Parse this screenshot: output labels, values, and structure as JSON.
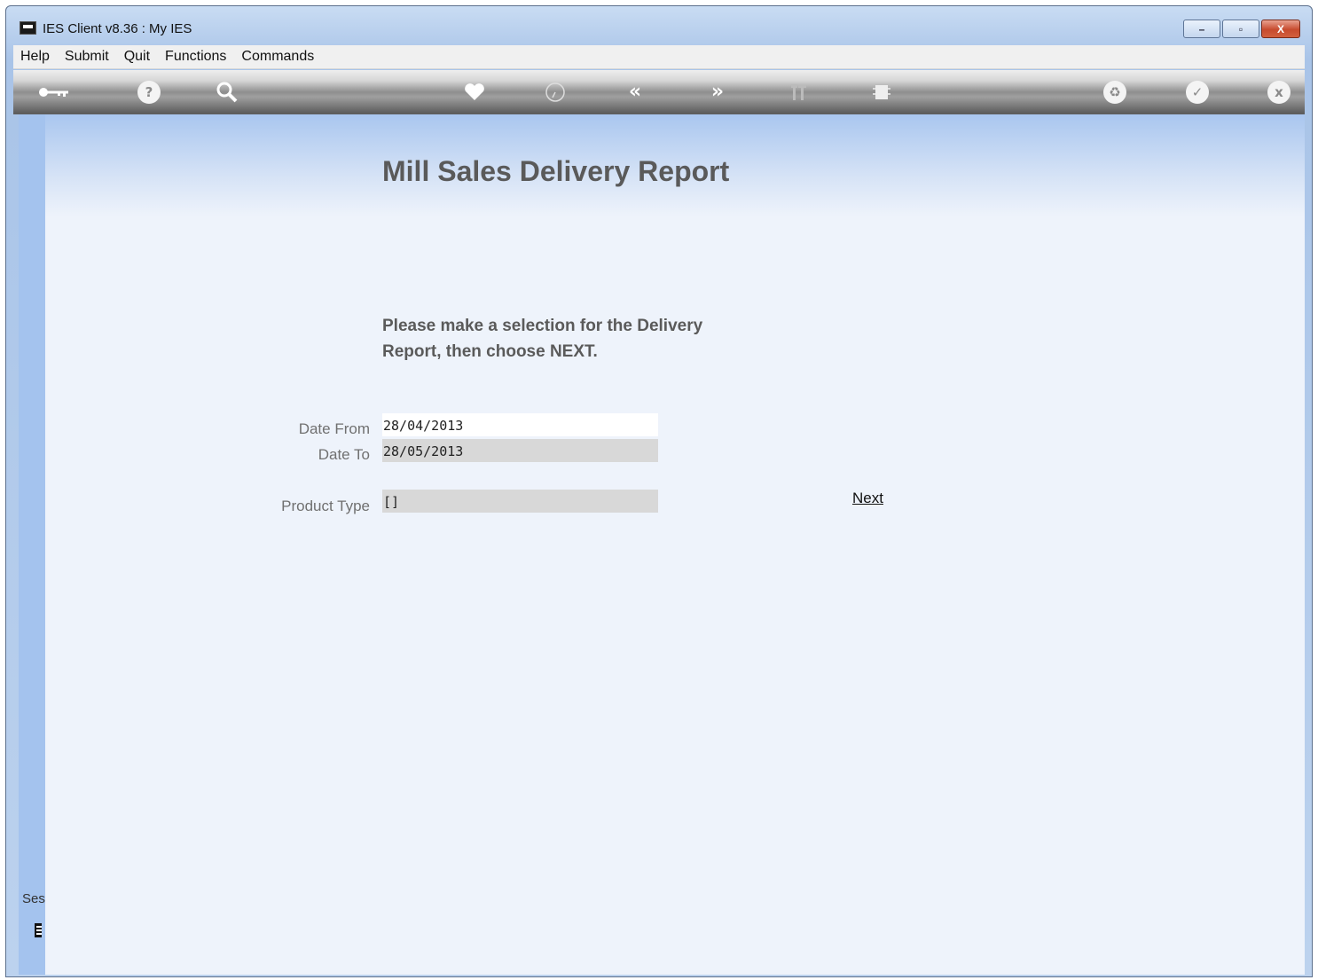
{
  "window": {
    "title": "IES Client v8.36 : My IES",
    "controls": {
      "minimize": "–",
      "maximize": "▫",
      "close": "X"
    }
  },
  "menubar": {
    "items": [
      "Help",
      "Submit",
      "Quit",
      "Functions",
      "Commands"
    ]
  },
  "toolbar": {
    "icons": [
      "key-icon",
      "help-icon",
      "search-icon",
      "favorite-heart-icon",
      "history-clock-icon",
      "previous-icon",
      "next-icon",
      "tools-icon",
      "chip-icon",
      "recycle-icon",
      "ok-check-icon",
      "close-x-icon"
    ]
  },
  "form": {
    "title": "Mill Sales Delivery Report",
    "instructions": "Please make a selection for the Delivery Report, then choose NEXT.",
    "fields": [
      {
        "label": "Date From",
        "value": "28/04/2013"
      },
      {
        "label": "Date To",
        "value": "28/05/2013"
      },
      {
        "label": "Product Type",
        "value": "[]"
      }
    ],
    "next_label": "Next"
  },
  "sidebar": {
    "label": "Ses"
  },
  "colors": {
    "title_text": "#5a5a5a",
    "field_label": "#707070",
    "active_field_bg": "#ffffff",
    "inactive_field_bg": "#d8d8d8",
    "pane_bg": "#eef3fb",
    "sidebar_bg": "#a4c3ee"
  }
}
